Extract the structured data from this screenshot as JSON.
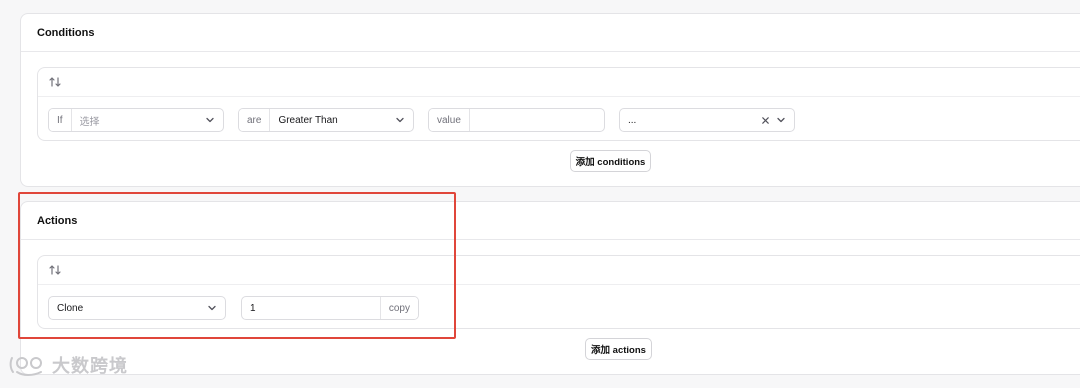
{
  "conditions": {
    "title": "Conditions",
    "row": {
      "if_label": "If",
      "field_placeholder": "选择",
      "operator_prefix": "are",
      "operator_value": "Greater Than",
      "value_label": "value",
      "value_input": "",
      "extra_value": "..."
    },
    "add_button": "添加 conditions"
  },
  "actions": {
    "title": "Actions",
    "row": {
      "action_value": "Clone",
      "amount_value": "1",
      "amount_suffix": "copy"
    },
    "add_button": "添加 actions"
  },
  "watermark": {
    "text": "大数跨境"
  },
  "icons": {
    "sort": "sort-arrows-icon",
    "chevron": "chevron-down-icon",
    "clear": "close-icon"
  },
  "colors": {
    "highlight": "#e0463a"
  }
}
